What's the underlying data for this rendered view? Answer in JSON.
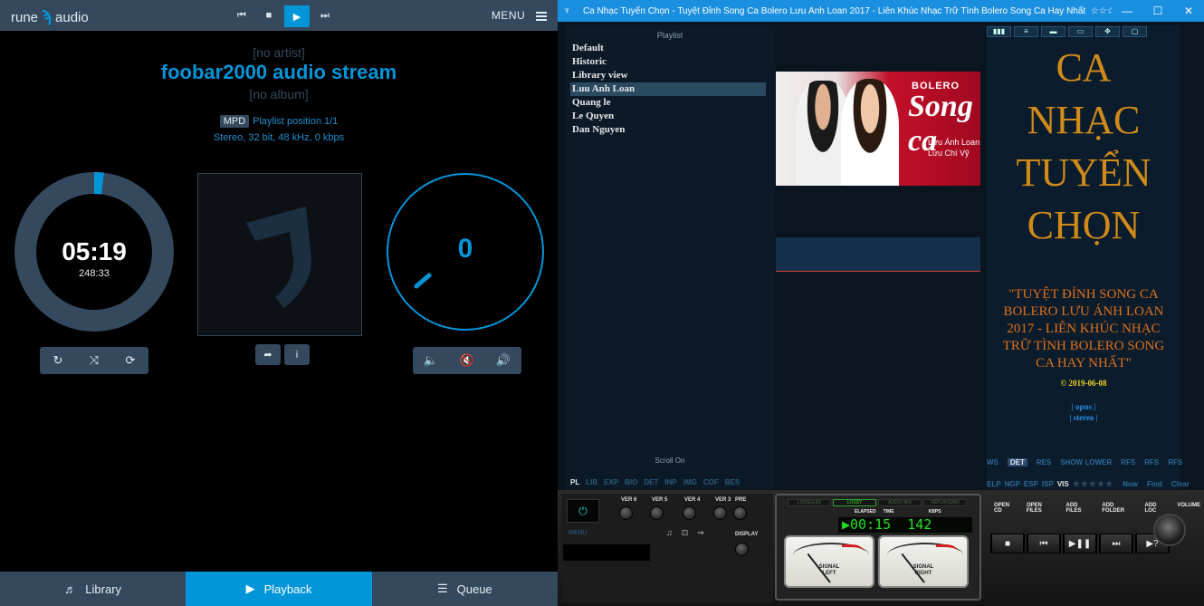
{
  "rune": {
    "logo_left": "rune",
    "logo_right": "audio",
    "menu_label": "MENU",
    "artist": "[no artist]",
    "title": "foobar2000 audio stream",
    "album": "[no album]",
    "source_badge": "MPD",
    "playlist_position": "Playlist position 1/1",
    "format": "Stereo, 32 bit, 48 kHz, 0 kbps",
    "elapsed": "05:19",
    "total": "248:33",
    "volume": "0",
    "progress_fraction": 0.02,
    "tabs": [
      {
        "label": "Library",
        "icon": "music-note-icon"
      },
      {
        "label": "Playback",
        "icon": "play-icon"
      },
      {
        "label": "Queue",
        "icon": "list-icon"
      }
    ],
    "colors": {
      "accent": "#0095d8",
      "bar": "#34495e"
    }
  },
  "foobar": {
    "window_title": "Ca Nhạc Tuyển Chọn - Tuyệt Đỉnh Song Ca Bolero Lưu Ánh Loan 2017 - Liên Khúc Nhạc Trữ Tình Bolero Song Ca Hay Nhất",
    "window_rating": "☆☆☆☆☆",
    "playlist_header": "Playlist",
    "playlists": [
      "Default",
      "Historic",
      "Library view",
      "Luu Anh Loan",
      "Quang le",
      "Le Quyen",
      "Dan Nguyen"
    ],
    "scroll_label": "Scroll On",
    "left_tabs": [
      "PL",
      "LIB",
      "EXP",
      "BIO",
      "DET",
      "INP",
      "IMG",
      "COF",
      "BES"
    ],
    "art_text": {
      "brand": "BOLERO",
      "script": "Song ca",
      "name1": "Lưu Ánh Loan",
      "name2": "Lưu Chí Vỹ"
    },
    "big_title_lines": [
      "CA",
      "NHẠC",
      "TUYỂN",
      "CHỌN"
    ],
    "description": "\"TUYỆT ĐỈNH SONG CA BOLERO LƯU ÁNH LOAN 2017 - LIÊN KHÚC NHẠC TRỮ TÌNH BOLERO SONG CA HAY NHẤT\"",
    "date": "© 2019-06-08",
    "codec": "| opus |",
    "channels": "| stereo |",
    "right_tabs1": [
      "WS",
      "DET",
      "RES",
      "SHOW LOWER",
      "RFS",
      "RFS",
      "RFS"
    ],
    "right_tabs2": [
      "ELP",
      "NGP",
      "ESP",
      "ISP",
      "VIS"
    ],
    "right_tabs2_rating": "★★★★★",
    "right_tabs2_extra": [
      "Now",
      "Find",
      "Clear"
    ],
    "deck": {
      "menu_label": "MENU",
      "knobs": [
        "VER 6",
        "VER 5",
        "VER 4",
        "VER 3",
        "PRE"
      ],
      "display_label": "DISPLAY",
      "modes": [
        "LOSSLESS",
        "LOSSY",
        "AUDIO MIX",
        "REPLAYGAIN"
      ],
      "lcd_labels": [
        "TRACK",
        "TOTAL",
        "ELAPSED",
        "TIME",
        "KBPS"
      ],
      "lcd_time": "00:15",
      "lcd_kbps": "142",
      "meter_left": "SIGNAL\nLEFT",
      "meter_right": "SIGNAL\nRIGHT",
      "right_labels": [
        "OPEN CD",
        "OPEN FILES",
        "ADD FILES",
        "ADD FOLDER",
        "ADD LOC",
        "VOLUME"
      ]
    }
  }
}
